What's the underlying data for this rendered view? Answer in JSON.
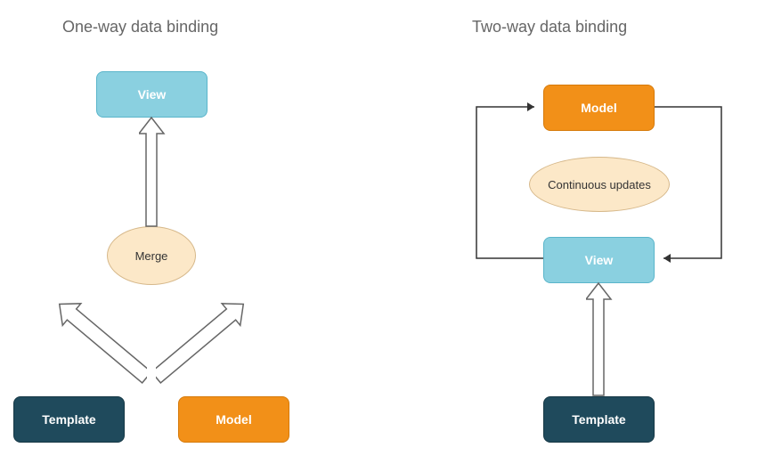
{
  "left": {
    "title": "One-way data binding",
    "view": "View",
    "merge": "Merge",
    "template": "Template",
    "model": "Model"
  },
  "right": {
    "title": "Two-way data binding",
    "model": "Model",
    "updates": "Continuous updates",
    "view": "View",
    "template": "Template"
  },
  "colors": {
    "view": "#8ad0e0",
    "model": "#f29018",
    "template": "#1f4a5c",
    "ellipse": "#fce8c8"
  }
}
